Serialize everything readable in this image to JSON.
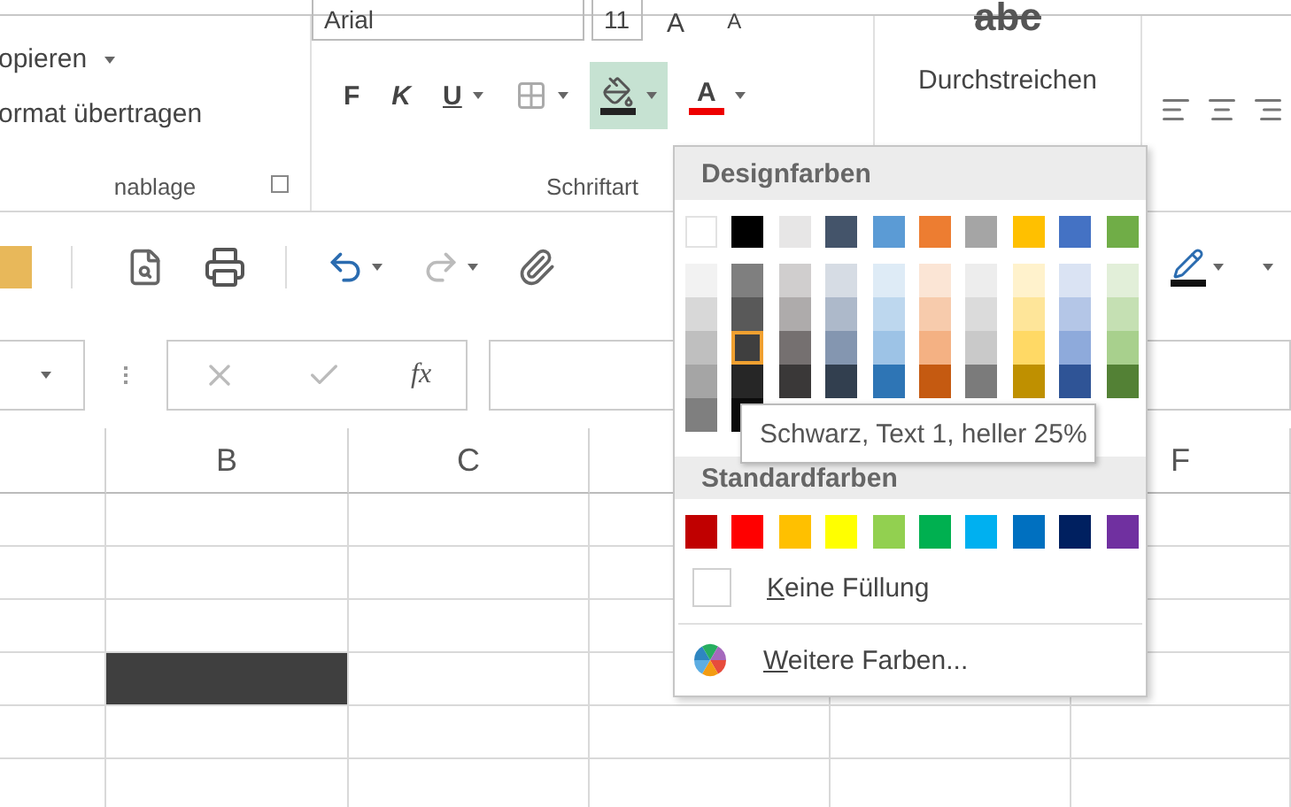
{
  "ribbon": {
    "clipboard": {
      "items": [
        {
          "label": "opieren",
          "has_menu": true
        },
        {
          "label": "ormat übertragen",
          "has_menu": false
        }
      ],
      "group_label": "nablage"
    },
    "font": {
      "font_name": "Arial",
      "font_size": "11",
      "grow_shrink": [
        "A",
        "A"
      ],
      "tools": [
        {
          "kind": "bold",
          "label": "F",
          "active": false
        },
        {
          "kind": "italic",
          "label": "K",
          "active": false
        },
        {
          "kind": "underline",
          "label": "U",
          "active": false
        },
        {
          "kind": "borders",
          "active": false
        },
        {
          "kind": "fill",
          "active": true
        },
        {
          "kind": "font_color",
          "label": "A",
          "active": false
        }
      ],
      "group_label": "Schriftart"
    },
    "strikethrough": {
      "icon_text": "abc",
      "label": "Durchstreichen"
    }
  },
  "formula_bar": {
    "fx": "fx"
  },
  "sheet": {
    "columns": [
      {},
      {
        "label": "B"
      },
      {
        "label": "C"
      },
      {},
      {},
      {
        "label": "F"
      }
    ],
    "rows": [
      {
        "filled": false
      },
      {
        "filled": false
      },
      {
        "filled": false
      },
      {
        "filled": true
      },
      {
        "filled": false
      },
      {
        "filled": false
      }
    ]
  },
  "color_menu": {
    "theme_header": "Designfarben",
    "theme_colors": [
      {
        "color": "#ffffff",
        "selected": false
      },
      {
        "color": "#000000",
        "selected": false
      },
      {
        "color": "#e7e6e6",
        "selected": false
      },
      {
        "color": "#44546a",
        "selected": false
      },
      {
        "color": "#5b9bd5",
        "selected": false
      },
      {
        "color": "#ed7d31",
        "selected": false
      },
      {
        "color": "#a5a5a5",
        "selected": false
      },
      {
        "color": "#ffc000",
        "selected": false
      },
      {
        "color": "#4472c4",
        "selected": false
      },
      {
        "color": "#70ad47",
        "selected": false
      }
    ],
    "shade_rows": [
      {
        "swatches": [
          {
            "color": "#f2f2f2",
            "selected": false
          },
          {
            "color": "#7f7f7f",
            "selected": false
          },
          {
            "color": "#d0cece",
            "selected": false
          },
          {
            "color": "#d6dce4",
            "selected": false
          },
          {
            "color": "#deebf6",
            "selected": false
          },
          {
            "color": "#fbe5d5",
            "selected": false
          },
          {
            "color": "#ededed",
            "selected": false
          },
          {
            "color": "#fff2cc",
            "selected": false
          },
          {
            "color": "#dae3f3",
            "selected": false
          },
          {
            "color": "#e2efd9",
            "selected": false
          }
        ]
      },
      {
        "swatches": [
          {
            "color": "#d8d8d8",
            "selected": false
          },
          {
            "color": "#595959",
            "selected": false
          },
          {
            "color": "#aeabab",
            "selected": false
          },
          {
            "color": "#adb9ca",
            "selected": false
          },
          {
            "color": "#bdd7ee",
            "selected": false
          },
          {
            "color": "#f7cbac",
            "selected": false
          },
          {
            "color": "#dbdbdb",
            "selected": false
          },
          {
            "color": "#fee599",
            "selected": false
          },
          {
            "color": "#b4c6e7",
            "selected": false
          },
          {
            "color": "#c5e0b3",
            "selected": false
          }
        ]
      },
      {
        "swatches": [
          {
            "color": "#bfbfbf",
            "selected": false
          },
          {
            "color": "#3f3f3f",
            "selected": true
          },
          {
            "color": "#757070",
            "selected": false
          },
          {
            "color": "#8496b0",
            "selected": false
          },
          {
            "color": "#9dc3e6",
            "selected": false
          },
          {
            "color": "#f4b183",
            "selected": false
          },
          {
            "color": "#c9c9c9",
            "selected": false
          },
          {
            "color": "#ffd965",
            "selected": false
          },
          {
            "color": "#8eaadb",
            "selected": false
          },
          {
            "color": "#a8d08d",
            "selected": false
          }
        ]
      },
      {
        "swatches": [
          {
            "color": "#a5a5a5",
            "selected": false
          },
          {
            "color": "#262626",
            "selected": false
          },
          {
            "color": "#3a3838",
            "selected": false
          },
          {
            "color": "#323f4f",
            "selected": false
          },
          {
            "color": "#2e75b5",
            "selected": false
          },
          {
            "color": "#c55a11",
            "selected": false
          },
          {
            "color": "#7b7b7b",
            "selected": false
          },
          {
            "color": "#bf9000",
            "selected": false
          },
          {
            "color": "#2f5496",
            "selected": false
          },
          {
            "color": "#538135",
            "selected": false
          }
        ]
      },
      {
        "swatches": [
          {
            "color": "#7f7f7f",
            "selected": false
          },
          {
            "color": "#0c0c0c",
            "selected": false
          }
        ]
      }
    ],
    "standard_header": "Standardfarben",
    "standard_colors": [
      {
        "color": "#c00000",
        "selected": false
      },
      {
        "color": "#ff0000",
        "selected": false
      },
      {
        "color": "#ffc000",
        "selected": false
      },
      {
        "color": "#ffff00",
        "selected": false
      },
      {
        "color": "#92d050",
        "selected": false
      },
      {
        "color": "#00b050",
        "selected": false
      },
      {
        "color": "#00b0f0",
        "selected": false
      },
      {
        "color": "#0070c0",
        "selected": false
      },
      {
        "color": "#002060",
        "selected": false
      },
      {
        "color": "#7030a0",
        "selected": false
      }
    ],
    "no_fill": "Keine Füllung",
    "more_colors": "Weitere Farben..."
  },
  "tooltip": "Schwarz, Text 1, heller 25%"
}
